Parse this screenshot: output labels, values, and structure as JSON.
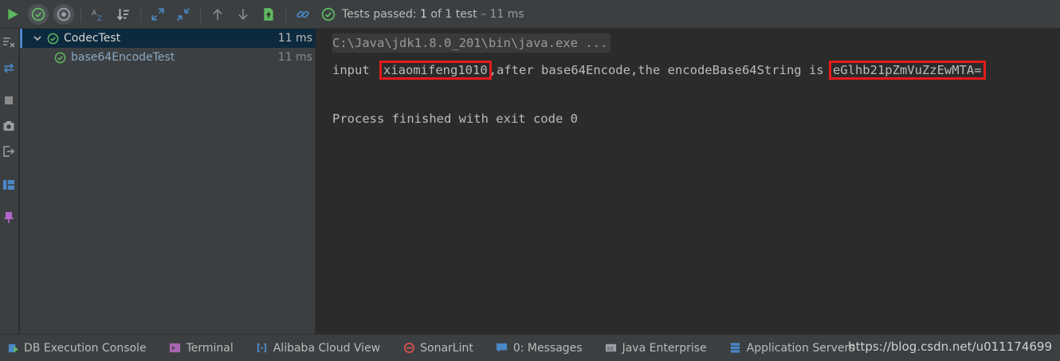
{
  "toolbar": {
    "status_prefix": "Tests passed:",
    "status_count": "1",
    "status_suffix": "of 1 test",
    "status_time": "– 11 ms",
    "icons": [
      "run-icon",
      "show-passed-icon",
      "show-ignored-icon",
      "sort-alpha-icon",
      "sort-duration-icon",
      "expand-all-icon",
      "collapse-all-icon",
      "prev-test-icon",
      "next-test-icon",
      "export-icon",
      "link-icon",
      "check-icon"
    ]
  },
  "tree": {
    "items": [
      {
        "name": "CodecTest",
        "time": "11 ms"
      },
      {
        "name": "base64EncodeTest",
        "time": "11 ms"
      }
    ]
  },
  "console": {
    "command": "C:\\Java\\jdk1.8.0_201\\bin\\java.exe ...",
    "output_prefix": "input",
    "input_value": "xiaomifeng1010",
    "output_middle": ",after base64Encode,the encodeBase64String is",
    "encoded_value": "eGlhb21pZmVuZzEwMTA=",
    "process_line": "Process finished with exit code 0"
  },
  "bottombar": {
    "items": [
      {
        "label": "DB Execution Console",
        "icon": "db-console-icon"
      },
      {
        "label": "Terminal",
        "icon": "terminal-icon"
      },
      {
        "label": "Alibaba Cloud View",
        "icon": "cloud-icon"
      },
      {
        "label": "SonarLint",
        "icon": "sonarlint-icon"
      },
      {
        "label": "0: Messages",
        "icon": "messages-icon"
      },
      {
        "label": "Java Enterprise",
        "icon": "java-enterprise-icon"
      },
      {
        "label": "Application Servers",
        "icon": "app-servers-icon"
      }
    ],
    "watermark": "https://blog.csdn.net/u011174699"
  },
  "colors": {
    "accent_green": "#5fb85f",
    "highlight_red": "#e51b1b",
    "selection": "#0d293e"
  }
}
